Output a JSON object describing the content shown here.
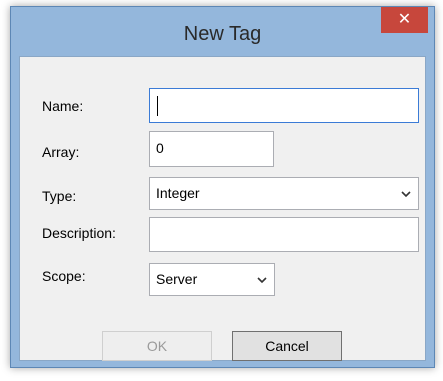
{
  "dialog": {
    "title": "New Tag",
    "close_glyph": "✕"
  },
  "form": {
    "name": {
      "label": "Name:",
      "value": ""
    },
    "array": {
      "label": "Array:",
      "value": "0"
    },
    "type": {
      "label": "Type:",
      "value": "Integer"
    },
    "description": {
      "label": "Description:",
      "value": ""
    },
    "scope": {
      "label": "Scope:",
      "value": "Server"
    }
  },
  "buttons": {
    "ok": "OK",
    "cancel": "Cancel"
  },
  "colors": {
    "frame": "#94b7dc",
    "close": "#c7473c",
    "client": "#f0f0f0",
    "focus_border": "#3b7bd6"
  }
}
